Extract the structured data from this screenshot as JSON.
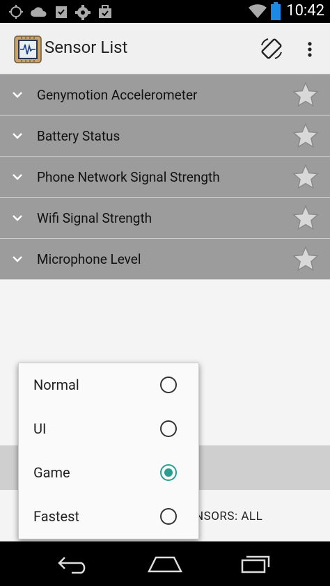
{
  "status_bar": {
    "time": "10:42",
    "left_icons": [
      "sync-icon",
      "cloud-icon",
      "clipboard-check-icon",
      "settings-icon",
      "briefcase-check-icon"
    ],
    "right_icons": [
      "wifi-icon",
      "battery-icon"
    ]
  },
  "action_bar": {
    "title": "Sensor List"
  },
  "sensors": [
    {
      "label": "Genymotion Accelerometer"
    },
    {
      "label": "Battery Status"
    },
    {
      "label": "Phone Network Signal Strength"
    },
    {
      "label": "Wifi Signal Strength"
    },
    {
      "label": "Microphone Level"
    }
  ],
  "footer": {
    "sensors_text": "NSORS: ALL"
  },
  "rate_popup": {
    "options": [
      {
        "label": "Normal",
        "selected": false
      },
      {
        "label": "UI",
        "selected": false
      },
      {
        "label": "Game",
        "selected": true
      },
      {
        "label": "Fastest",
        "selected": false
      }
    ]
  },
  "colors": {
    "row_bg": "#9c9c9c",
    "accent": "#2a9d8f"
  }
}
